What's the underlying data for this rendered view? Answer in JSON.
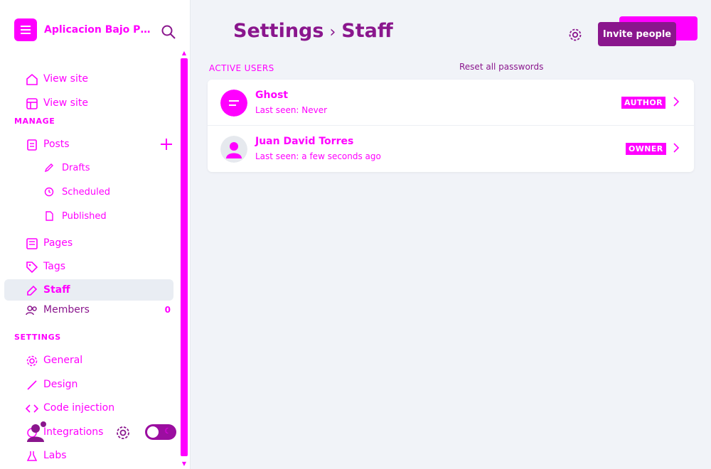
{
  "brand": {
    "name": "Aplicacion Bajo Pr..."
  },
  "colors": {
    "accent": "#ff00ff",
    "primary": "#8a168d",
    "bg": "#f1f3f8"
  },
  "sidebar": {
    "top_items": [
      {
        "label": "View site",
        "icon": "house-icon"
      },
      {
        "label": "View site",
        "icon": "layout-icon"
      }
    ],
    "manage_label": "MANAGE",
    "posts": {
      "label": "Posts",
      "icon": "posts-icon"
    },
    "post_subitems": [
      {
        "label": "Drafts",
        "icon": "pencil-icon"
      },
      {
        "label": "Scheduled",
        "icon": "clock-icon"
      },
      {
        "label": "Published",
        "icon": "document-icon"
      }
    ],
    "pages": {
      "label": "Pages",
      "icon": "pages-icon"
    },
    "tags": {
      "label": "Tags",
      "icon": "tag-icon"
    },
    "staff": {
      "label": "Staff",
      "icon": "staff-icon"
    },
    "members": {
      "label": "Members",
      "icon": "members-icon",
      "count": "0"
    },
    "settings_label": "SETTINGS",
    "settings_items": [
      {
        "label": "General",
        "icon": "gear-icon"
      },
      {
        "label": "Design",
        "icon": "brush-icon"
      },
      {
        "label": "Code injection",
        "icon": "code-icon"
      },
      {
        "label": "Integrations",
        "icon": "plug-icon"
      },
      {
        "label": "Labs",
        "icon": "flask-icon"
      }
    ]
  },
  "header": {
    "breadcrumb_parent": "Settings",
    "breadcrumb_current": "Staff",
    "invite_label": "Invite people"
  },
  "staff": {
    "section_label": "ACTIVE USERS",
    "reset_label": "Reset all passwords",
    "users": [
      {
        "name": "Ghost",
        "last_seen": "Last seen: Never",
        "role": "AUTHOR"
      },
      {
        "name": "Juan David Torres",
        "last_seen": "Last seen: a few seconds ago",
        "role": "OWNER"
      }
    ]
  }
}
